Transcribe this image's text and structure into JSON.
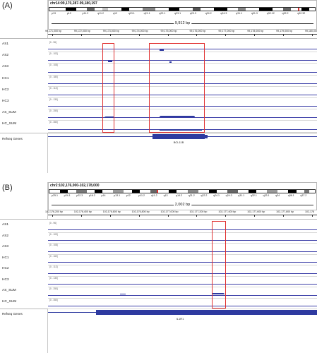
{
  "colors": {
    "track_line": "#3c3fa8",
    "highlight_box": "#e03030",
    "gene": "#2e3aa0"
  },
  "panel_a": {
    "label": "(A)",
    "locus": "chr14:99,170,287-99,180,197",
    "bands": [
      "p13",
      "p12",
      "p11.2",
      "q11.2",
      "q12",
      "q13.1",
      "q21.1",
      "q22.1",
      "q23.1",
      "q23.3",
      "q24.2",
      "q24.3",
      "q31.1",
      "q31.3",
      "q32.12",
      "q32.2",
      "q32.32"
    ],
    "span": "9,912 bp",
    "ticks": [
      "99,171,000 bp",
      "99,172,000 bp",
      "99,173,000 bp",
      "99,174,000 bp",
      "99,175,000 bp",
      "99,176,000 bp",
      "99,177,000 bp",
      "99,178,000 bp",
      "99,179,000 bp",
      "99,180,000 bp"
    ],
    "tracks": [
      {
        "name": "AS1",
        "range": "[0 - 96]"
      },
      {
        "name": "AS2",
        "range": "[0 - 103]"
      },
      {
        "name": "AS3",
        "range": "[0 - 108]"
      },
      {
        "name": "HC1",
        "range": "[0 - 180]"
      },
      {
        "name": "HC2",
        "range": "[0 - 113]"
      },
      {
        "name": "HC3",
        "range": "[0 - 130]"
      },
      {
        "name": "AS_SUM",
        "range": "[0 - 250]"
      },
      {
        "name": "HC_SUM",
        "range": "[0 - 350]"
      }
    ],
    "refseq_label": "Refseq Genes",
    "gene_name": "BCL11B"
  },
  "panel_b": {
    "label": "(B)",
    "locus": "chr2:102,176,000-102,178,000",
    "bands": [
      "p25.1",
      "p24.1",
      "p22.3",
      "p16.2",
      "p14",
      "p13.1",
      "p12",
      "p11.2",
      "q11.2",
      "q13",
      "q14.2",
      "q21.2",
      "q22.2",
      "q24.1",
      "q24.3",
      "q31.1",
      "q32.1",
      "q33.1",
      "q34",
      "q36.1",
      "q37.2"
    ],
    "span": "2,002 bp",
    "ticks": [
      "102,176,200 bp",
      "102,176,400 bp",
      "102,176,600 bp",
      "102,176,800 bp",
      "102,177,000 bp",
      "102,177,200 bp",
      "102,177,400 bp",
      "102,177,600 bp",
      "102,177,800 bp",
      "102,178"
    ],
    "tracks": [
      {
        "name": "AS1",
        "range": "[0 - 96]"
      },
      {
        "name": "AS2",
        "range": "[0 - 103]"
      },
      {
        "name": "AS3",
        "range": "[0 - 108]"
      },
      {
        "name": "HC1",
        "range": "[0 - 160]"
      },
      {
        "name": "HC2",
        "range": "[0 - 113]"
      },
      {
        "name": "HC3",
        "range": "[0 - 130]"
      },
      {
        "name": "AS_SUM",
        "range": "[0 - 250]"
      },
      {
        "name": "HC_SUM",
        "range": "[0 - 350]"
      }
    ],
    "refseq_label": "Refseq Genes",
    "gene_name": "IL1R1"
  }
}
